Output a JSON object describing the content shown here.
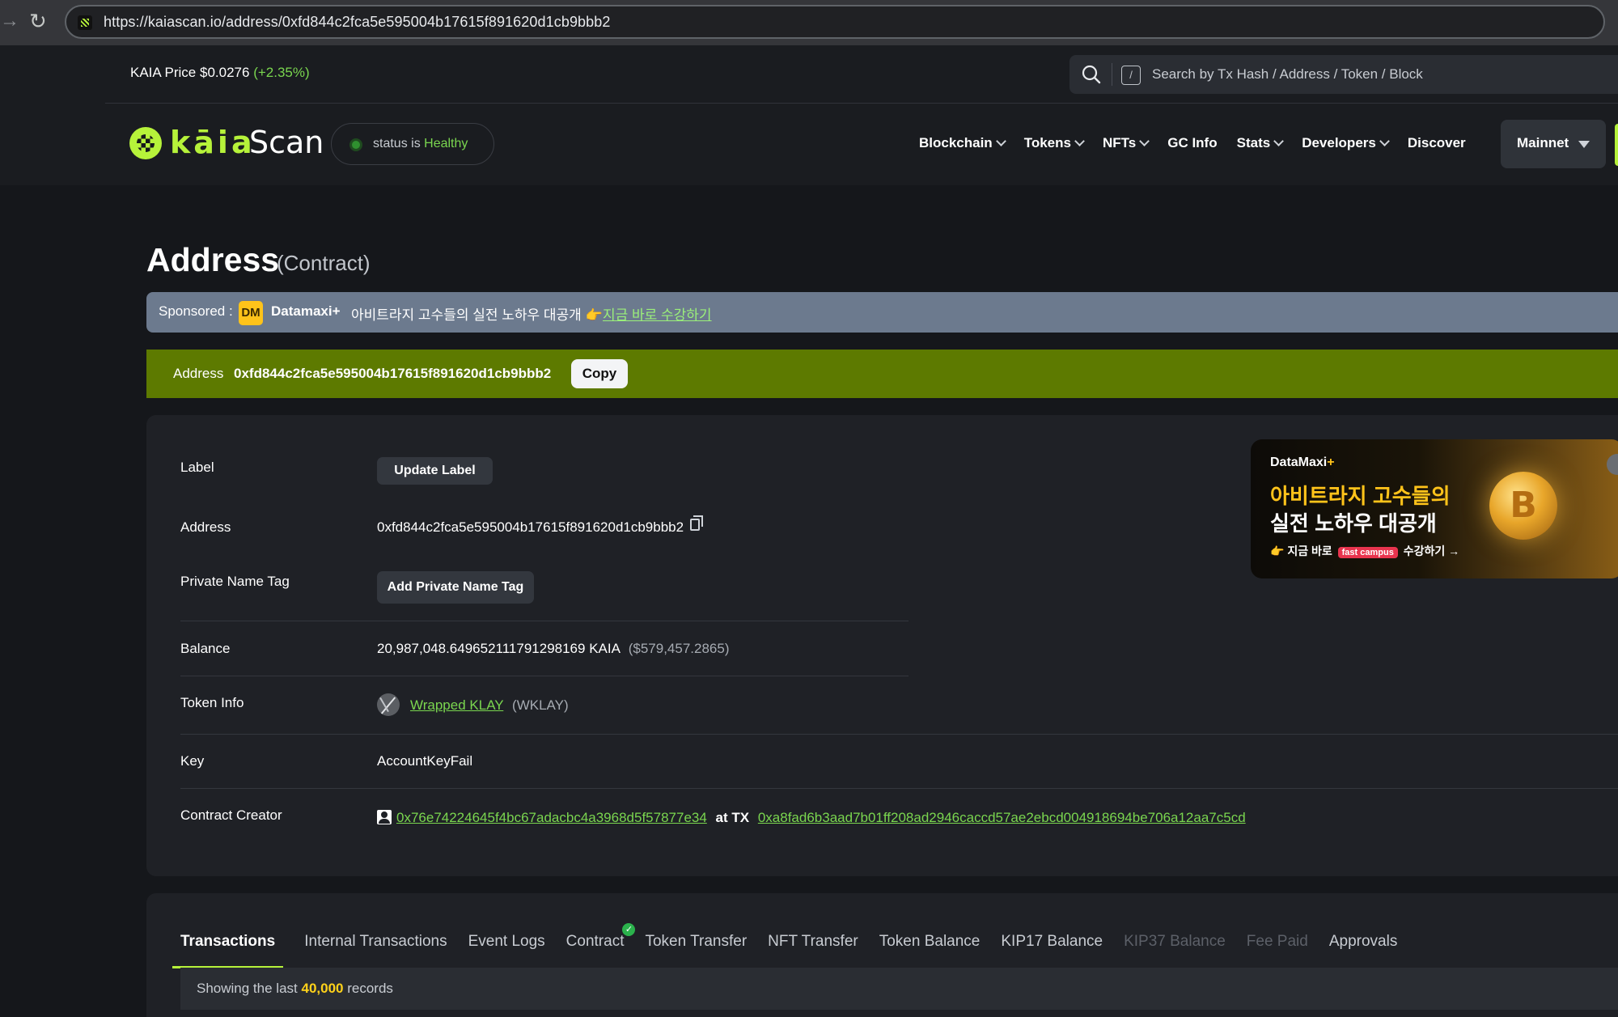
{
  "browser": {
    "url": "https://kaiascan.io/address/0xfd844c2fca5e595004b17615f891620d1cb9bbb2"
  },
  "topbar": {
    "price_label": "KAIA Price",
    "price_value": "$0.0276",
    "price_change": "(+2.35%)",
    "search_placeholder": "Search by Tx Hash / Address / Token / Block",
    "search_shortcut": "/"
  },
  "header": {
    "logo_word": "kāia",
    "logo_scan": "Scan",
    "status_prefix": "status is",
    "status_value": "Healthy",
    "nav": [
      {
        "label": "Blockchain",
        "dropdown": true
      },
      {
        "label": "Tokens",
        "dropdown": true
      },
      {
        "label": "NFTs",
        "dropdown": true
      },
      {
        "label": "GC Info",
        "dropdown": false
      },
      {
        "label": "Stats",
        "dropdown": true
      },
      {
        "label": "Developers",
        "dropdown": true
      },
      {
        "label": "Discover",
        "dropdown": false
      }
    ],
    "network": "Mainnet"
  },
  "page": {
    "title": "Address",
    "subtitle": "(Contract)"
  },
  "sponsor": {
    "label": "Sponsored :",
    "icon_text": "DM",
    "name": "Datamaxi+",
    "text": "아비트라지 고수들의 실전 노하우 대공개 👉",
    "link": "지금 바로 수강하기"
  },
  "address_bar": {
    "label": "Address",
    "value": "0xfd844c2fca5e595004b17615f891620d1cb9bbb2",
    "copy_label": "Copy"
  },
  "details": {
    "label_row": {
      "label": "Label",
      "value": "-",
      "button": "Update Label"
    },
    "address_row": {
      "label": "Address",
      "value": "0xfd844c2fca5e595004b17615f891620d1cb9bbb2"
    },
    "private_tag_row": {
      "label": "Private Name Tag",
      "button": "Add Private Name Tag"
    },
    "balance_row": {
      "label": "Balance",
      "value": "20,987,048.649652111791298169 KAIA",
      "usd": "($579,457.2865)"
    },
    "token_row": {
      "label": "Token Info",
      "name": "Wrapped KLAY",
      "symbol": "(WKLAY)"
    },
    "key_row": {
      "label": "Key",
      "value": "AccountKeyFail"
    },
    "creator_row": {
      "label": "Contract Creator",
      "creator": "0x76e74224645f4bc67adacbc4a3968d5f57877e34",
      "at_tx": "at TX",
      "tx": "0xa8fad6b3aad7b01ff208ad2946caccd57ae2ebcd004918694be706a12aa7c5cd"
    }
  },
  "ad": {
    "brand": "DataMaxi",
    "brand_plus": "+",
    "line1": "아비트라지 고수들의",
    "line2": "실전 노하우 대공개",
    "cta_prefix": "👉 지금 바로",
    "cta_badge": "fast campus",
    "cta_suffix": "수강하기 →"
  },
  "tabs": {
    "items": [
      {
        "label": "Transactions",
        "state": "active"
      },
      {
        "label": "Internal Transactions",
        "state": "normal"
      },
      {
        "label": "Event Logs",
        "state": "normal"
      },
      {
        "label": "Contract",
        "state": "verified"
      },
      {
        "label": "Token Transfer",
        "state": "normal"
      },
      {
        "label": "NFT Transfer",
        "state": "normal"
      },
      {
        "label": "Token Balance",
        "state": "normal"
      },
      {
        "label": "KIP17 Balance",
        "state": "normal"
      },
      {
        "label": "KIP37 Balance",
        "state": "disabled"
      },
      {
        "label": "Fee Paid",
        "state": "disabled"
      },
      {
        "label": "Approvals",
        "state": "normal"
      }
    ],
    "records_prefix": "Showing the last",
    "records_count": "40,000",
    "records_suffix": "records"
  },
  "colors": {
    "brand": "#b6f23a",
    "address_bar": "#5d7a00",
    "sponsor_bar": "#6c7a8e",
    "link": "#7ad64f",
    "records_count": "#ffd21a"
  }
}
